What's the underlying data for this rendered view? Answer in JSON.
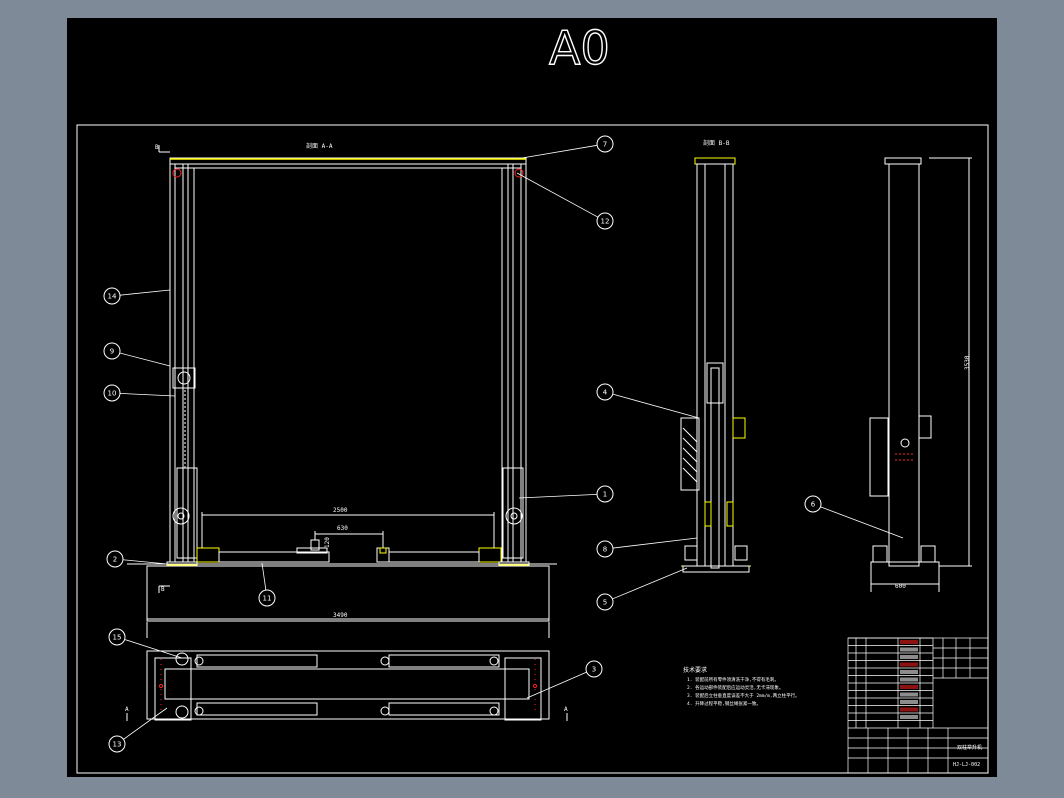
{
  "sheet": {
    "size_label": "A0",
    "section_aa": "剖面 A-A",
    "section_bb": "剖面 B-B",
    "mark_a": "A",
    "mark_b": "B"
  },
  "dimensions": {
    "span_top": "2500",
    "gap": "630",
    "overall_width": "3490",
    "height_side": "3530",
    "base_side": "600",
    "small": "120"
  },
  "callouts": [
    "1",
    "2",
    "3",
    "4",
    "5",
    "6",
    "7",
    "8",
    "9",
    "10",
    "11",
    "12",
    "13",
    "14",
    "15"
  ],
  "notes": {
    "title": "技术要求",
    "lines": [
      "1. 装配前所有零件须清洗干净,不得有毛刺。",
      "2. 各运动部件装配后应运动灵活,无卡滞现象。",
      "3. 装配后立柱垂直度误差不大于 2mm/m,两立柱平行。",
      "4. 升降过程平稳,钢丝绳张紧一致。"
    ]
  },
  "title_block": {
    "drawing_no": "HJ-LJ-002",
    "title": "双柱举升机"
  },
  "colors": {
    "line": "#ffffff",
    "yellow": "#ffff00",
    "red": "#ff2020",
    "background": "#000000",
    "frame": "#7f8a99"
  }
}
